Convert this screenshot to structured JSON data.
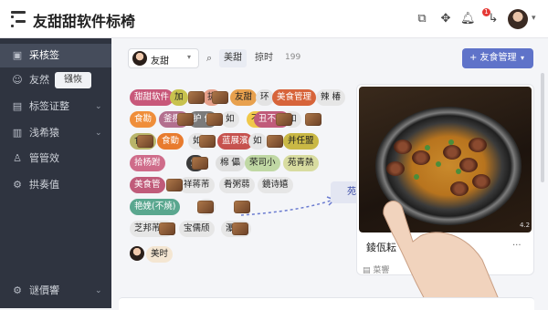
{
  "app": {
    "title": "友甜甜软件标椅"
  },
  "topbar": {
    "notification_count": "1",
    "icons": [
      "shortcut-icon",
      "puzzle-icon",
      "bell-icon",
      "logout-icon",
      "user-avatar",
      "chevron-down-icon"
    ]
  },
  "sidebar": {
    "items": [
      {
        "label": "采核签",
        "icon": "image-icon",
        "active": true
      },
      {
        "label": "友然",
        "icon": "users-icon",
        "tooltip": "镪恢"
      },
      {
        "label": "标签证整",
        "icon": "tag-icon",
        "chevron": "⌄"
      },
      {
        "label": "浅希猿",
        "icon": "folder-icon",
        "chevron": "⌄"
      },
      {
        "label": "管管效",
        "icon": "person-icon"
      },
      {
        "label": "拱奏值",
        "icon": "settings-icon"
      },
      {
        "label": "谜價響",
        "icon": "gear-icon",
        "chevron": "⌄"
      }
    ]
  },
  "filter": {
    "user": "友甜",
    "search_icon": "search-icon",
    "tabs": [
      {
        "label": "美甜",
        "active": true
      },
      {
        "label": "掠时"
      }
    ],
    "count": "199",
    "primary_button": "+  友食管理"
  },
  "tags": [
    {
      "label": "甜甜软件",
      "color": "#c8587a",
      "tc": "#fff"
    },
    {
      "label": "加",
      "color": "#c8c24e"
    },
    {
      "label": "拔",
      "color": "#e6a08a"
    },
    {
      "label": "友甜",
      "color": "#e8a14e"
    },
    {
      "label": "环",
      "color": "#e3e3e3"
    },
    {
      "label": "美食管理",
      "color": "#d7643a",
      "tc": "#fff"
    },
    {
      "label": "辣 椿",
      "color": "#e6e6e6"
    },
    {
      "label": "食勘",
      "color": "#ef8e3a",
      "tc": "#fff"
    },
    {
      "label": "釜攒)",
      "color": "#b3708f",
      "tc": "#fff"
    },
    {
      "label": "护 作",
      "color": "#7b7b7b",
      "tc": "#fff"
    },
    {
      "label": "如",
      "color": "#e6e6e6"
    },
    {
      "label": "不 馕",
      "color": "#f0c84a"
    },
    {
      "label": "丑不遇",
      "color": "#c05b7a",
      "tc": "#fff"
    },
    {
      "label": "如",
      "color": "#e6e6e6"
    },
    {
      "label": "食钛",
      "color": "#b9b56a"
    },
    {
      "label": "食動",
      "color": "#e87b2e",
      "tc": "#fff"
    },
    {
      "label": "如",
      "color": "#e6e6e6"
    },
    {
      "label": "蓝展濱",
      "color": "#c6524e",
      "tc": "#fff"
    },
    {
      "label": "如",
      "color": "#e6e6e6"
    },
    {
      "label": "并任盟",
      "color": "#c9b845"
    },
    {
      "label": "拾杨跗",
      "color": "#cf6c8a",
      "tc": "#fff"
    },
    {
      "label": "炸",
      "color": "#3a3a3a",
      "tc": "#fff"
    },
    {
      "label": "棉 儡",
      "color": "#e0e0e0"
    },
    {
      "label": "荣司小",
      "color": "#c0d8a4"
    },
    {
      "label": "苑青熱",
      "color": "#d8dca0"
    },
    {
      "label": "美食管",
      "color": "#c05b7a",
      "tc": "#fff"
    },
    {
      "label": "祥蒋芾",
      "color": "#e6e6e6"
    },
    {
      "label": "肴粥蒻",
      "color": "#e6e6e6"
    },
    {
      "label": "鏡诗嬉",
      "color": "#e6e6e6"
    },
    {
      "label": "艳娩(不燒)",
      "color": "#5aa78f",
      "tc": "#fff"
    },
    {
      "label": "垭",
      "color": "#e6e6e6"
    },
    {
      "label": "芝邦芾芾",
      "color": "#e6e6e6"
    },
    {
      "label": "宝儒颀",
      "color": "#e6e6e6"
    },
    {
      "label": "瀑猫)",
      "color": "#e6e6e6"
    },
    {
      "label": "美时",
      "color": "#f4e6d2"
    }
  ],
  "card": {
    "title": "錂佤耘",
    "photo_caption": "4.2",
    "meta": "菜響",
    "more": "..."
  },
  "drag_hint": "苑贵至朗"
}
